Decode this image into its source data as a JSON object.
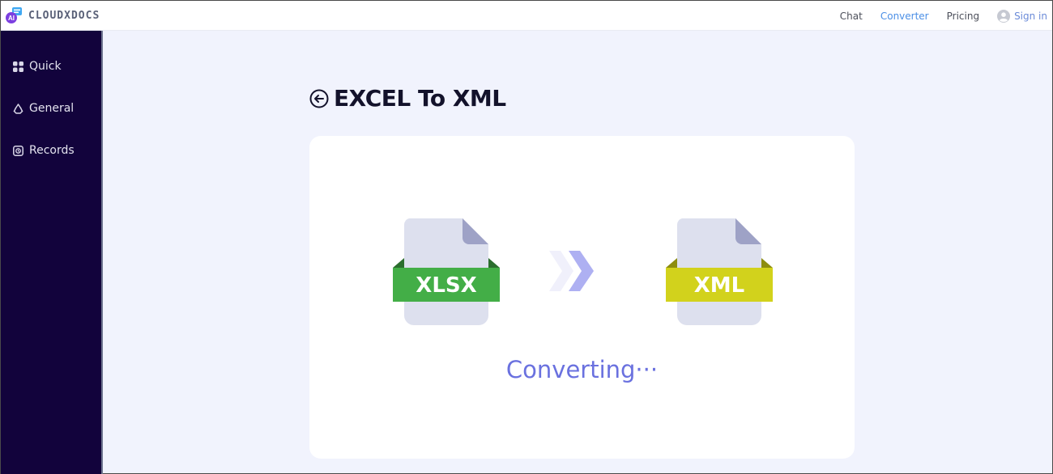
{
  "brand": {
    "name": "CLOUDXDOCS",
    "badge": "AI"
  },
  "nav": {
    "chat": "Chat",
    "converter": "Converter",
    "pricing": "Pricing",
    "sign_in": "Sign in"
  },
  "sidebar": {
    "items": [
      {
        "label": "Quick",
        "icon": "grid-icon"
      },
      {
        "label": "General",
        "icon": "recycle-icon"
      },
      {
        "label": "Records",
        "icon": "record-icon"
      }
    ]
  },
  "page": {
    "title": "EXCEL To XML"
  },
  "conversion": {
    "source_label": "XLSX",
    "target_label": "XML",
    "status": "Converting···"
  },
  "colors": {
    "sidebar_bg": "#12033c",
    "accent": "#4b8fe6",
    "xlsx_green": "#43ae47",
    "xml_yellow": "#d2d21c",
    "status_text": "#6a71df"
  }
}
